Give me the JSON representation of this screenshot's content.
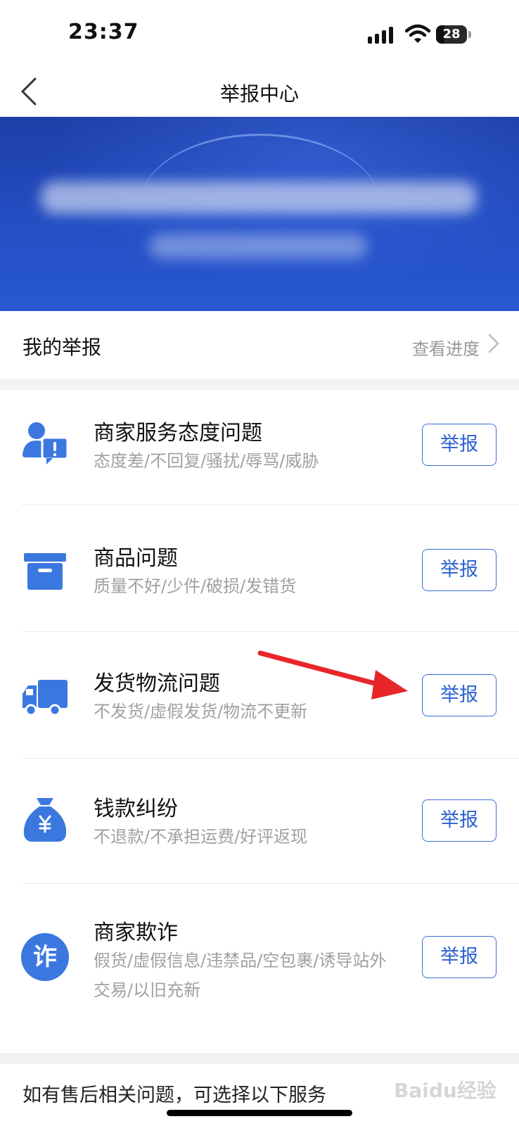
{
  "status_bar": {
    "time": "23:37",
    "battery": "28",
    "battery_level": 0.28
  },
  "nav": {
    "title": "举报中心"
  },
  "my_report": {
    "label": "我的举报",
    "link": "查看进度"
  },
  "items": [
    {
      "title": "商家服务态度问题",
      "desc": "态度差/不回复/骚扰/辱骂/威胁",
      "button": "举报",
      "icon": "person-alert-icon"
    },
    {
      "title": "商品问题",
      "desc": "质量不好/少件/破损/发错货",
      "button": "举报",
      "icon": "box-icon"
    },
    {
      "title": "发货物流问题",
      "desc": "不发货/虚假发货/物流不更新",
      "button": "举报",
      "icon": "truck-icon"
    },
    {
      "title": "钱款纠纷",
      "desc": "不退款/不承担运费/好评返现",
      "button": "举报",
      "icon": "money-bag-icon"
    },
    {
      "title": "商家欺诈",
      "desc": "假货/虚假信息/违禁品/空包裹/诱导站外交易/以旧充新",
      "button": "举报",
      "icon": "fraud-icon",
      "icon_text": "诈"
    }
  ],
  "footer": {
    "text": "如有售后相关问题，可选择以下服务"
  },
  "watermark": "Baidu经验",
  "colors": {
    "accent": "#3a78e0",
    "banner": "#2450c6",
    "annotation_arrow": "#e8262a"
  }
}
